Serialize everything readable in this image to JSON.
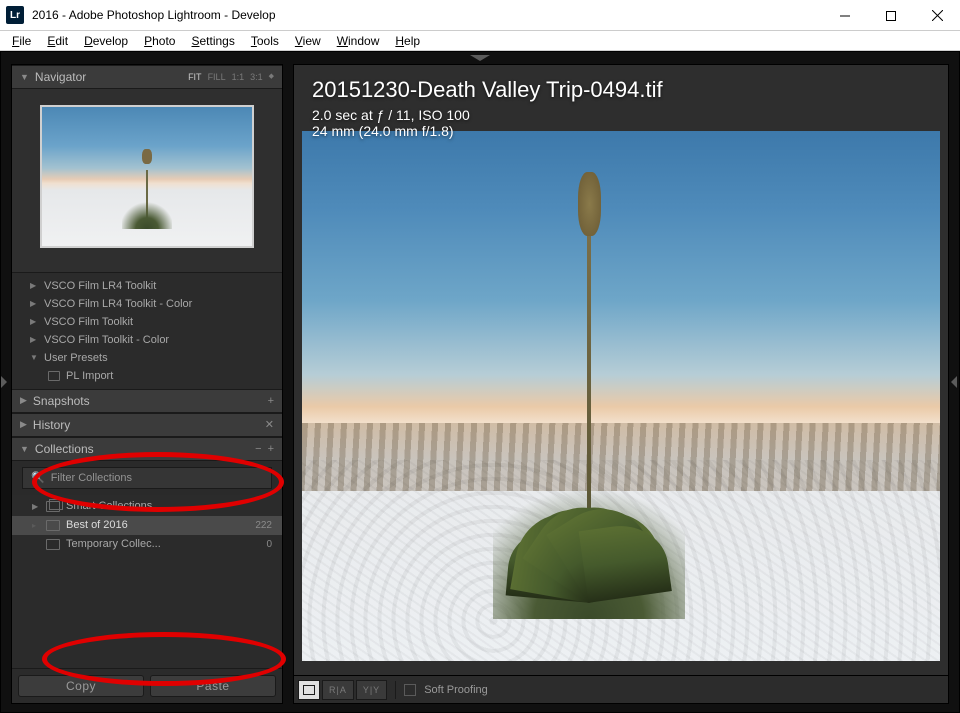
{
  "window": {
    "title": "2016 - Adobe Photoshop Lightroom - Develop",
    "app_icon": "Lr"
  },
  "menu": [
    "File",
    "Edit",
    "Develop",
    "Photo",
    "Settings",
    "Tools",
    "View",
    "Window",
    "Help"
  ],
  "navigator": {
    "title": "Navigator",
    "modes": [
      "FIT",
      "FILL",
      "1:1",
      "3:1"
    ],
    "active_mode": "FIT"
  },
  "presets": [
    {
      "label": "VSCO Film LR4 Toolkit",
      "expanded": false
    },
    {
      "label": "VSCO Film LR4 Toolkit - Color",
      "expanded": false
    },
    {
      "label": "VSCO Film Toolkit",
      "expanded": false
    },
    {
      "label": "VSCO Film Toolkit - Color",
      "expanded": false
    },
    {
      "label": "User Presets",
      "expanded": true,
      "children": [
        {
          "label": "PL Import"
        }
      ]
    }
  ],
  "snapshots": {
    "title": "Snapshots"
  },
  "history": {
    "title": "History"
  },
  "collections": {
    "title": "Collections",
    "filter_placeholder": "Filter Collections",
    "items": [
      {
        "label": "Smart Collections",
        "type": "smart",
        "count": ""
      },
      {
        "label": "Best of 2016",
        "type": "collection",
        "count": "222",
        "selected": true
      },
      {
        "label": "Temporary Collec...",
        "type": "collection",
        "count": "0"
      }
    ]
  },
  "buttons": {
    "copy": "Copy",
    "paste": "Paste"
  },
  "photo": {
    "filename": "20151230-Death Valley Trip-0494.tif",
    "exposure": "2.0 sec at ƒ / 11, ISO 100",
    "lens": "24 mm (24.0 mm f/1.8)"
  },
  "toolbar": {
    "buttons": [
      "loupe",
      "before-after-lr",
      "before-after-tb"
    ],
    "soft_proof_label": "Soft Proofing"
  }
}
